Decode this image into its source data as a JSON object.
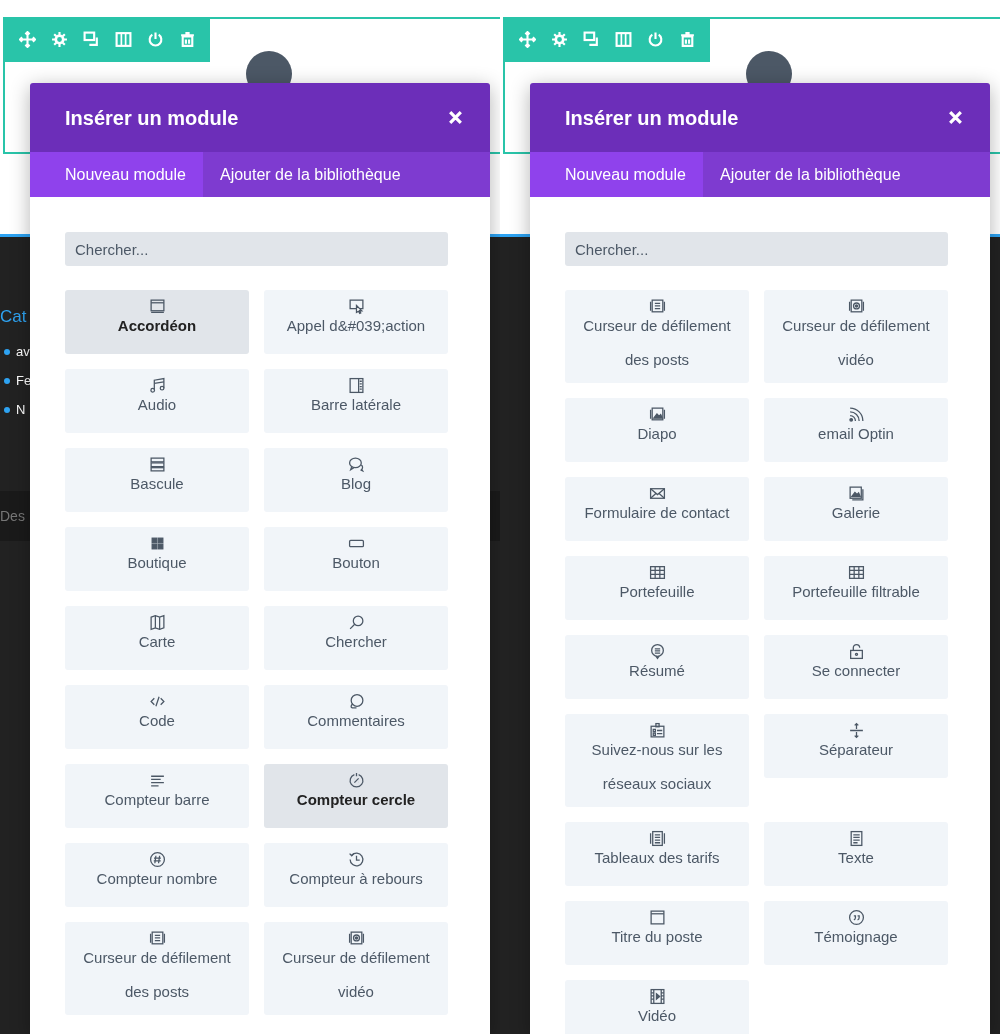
{
  "panels": [
    {
      "background": {
        "heading": "Cat",
        "bullets": [
          "av",
          "Fe",
          "N"
        ],
        "footer": "Des"
      },
      "modal": {
        "title": "Insérer un module",
        "tabs": [
          {
            "label": "Nouveau module",
            "selected": true
          },
          {
            "label": "Ajouter de la bibliothèque",
            "selected": false
          }
        ],
        "search": {
          "placeholder": "Chercher..."
        },
        "modules": [
          {
            "label": "Accordéon",
            "kind": "accordion",
            "highlighted": true
          },
          {
            "label": "Appel d&#039;action",
            "kind": "cta",
            "highlighted": false
          },
          {
            "label": "Audio",
            "kind": "audio",
            "highlighted": false
          },
          {
            "label": "Barre latérale",
            "kind": "sidebar",
            "highlighted": false
          },
          {
            "label": "Bascule",
            "kind": "toggle",
            "highlighted": false
          },
          {
            "label": "Blog",
            "kind": "blog",
            "highlighted": false
          },
          {
            "label": "Boutique",
            "kind": "shop",
            "highlighted": false
          },
          {
            "label": "Bouton",
            "kind": "button",
            "highlighted": false
          },
          {
            "label": "Carte",
            "kind": "map",
            "highlighted": false
          },
          {
            "label": "Chercher",
            "kind": "search",
            "highlighted": false
          },
          {
            "label": "Code",
            "kind": "code",
            "highlighted": false
          },
          {
            "label": "Commentaires",
            "kind": "comments",
            "highlighted": false
          },
          {
            "label": "Compteur barre",
            "kind": "barcounter",
            "highlighted": false
          },
          {
            "label": "Compteur cercle",
            "kind": "circlecounter",
            "highlighted": true
          },
          {
            "label": "Compteur nombre",
            "kind": "number",
            "highlighted": false
          },
          {
            "label": "Compteur à rebours",
            "kind": "countdown",
            "highlighted": false
          },
          {
            "label": "Curseur de défilement des posts",
            "kind": "postslider",
            "highlighted": false
          },
          {
            "label": "Curseur de défilement vidéo",
            "kind": "videoslider",
            "highlighted": false
          }
        ]
      }
    },
    {
      "modal": {
        "title": "Insérer un module",
        "tabs": [
          {
            "label": "Nouveau module",
            "selected": true
          },
          {
            "label": "Ajouter de la bibliothèque",
            "selected": false
          }
        ],
        "search": {
          "placeholder": "Chercher..."
        },
        "modules": [
          {
            "label": "Curseur de défilement des posts",
            "kind": "postslider",
            "highlighted": false
          },
          {
            "label": "Curseur de défilement vidéo",
            "kind": "videoslider",
            "highlighted": false
          },
          {
            "label": "Diapo",
            "kind": "slider",
            "highlighted": false
          },
          {
            "label": "email Optin",
            "kind": "optin",
            "highlighted": false
          },
          {
            "label": "Formulaire de contact",
            "kind": "contact",
            "highlighted": false
          },
          {
            "label": "Galerie",
            "kind": "gallery",
            "highlighted": false
          },
          {
            "label": "Portefeuille",
            "kind": "portfolio",
            "highlighted": false
          },
          {
            "label": "Portefeuille filtrable",
            "kind": "portfolio",
            "highlighted": false
          },
          {
            "label": "Résumé",
            "kind": "summary",
            "highlighted": false
          },
          {
            "label": "Se connecter",
            "kind": "login",
            "highlighted": false
          },
          {
            "label": "Suivez-nous sur les réseaux sociaux",
            "kind": "social",
            "highlighted": false
          },
          {
            "label": "Séparateur",
            "kind": "divider",
            "highlighted": false
          },
          {
            "label": "Tableaux des tarifs",
            "kind": "pricing",
            "highlighted": false
          },
          {
            "label": "Texte",
            "kind": "text",
            "highlighted": false
          },
          {
            "label": "Titre du poste",
            "kind": "posttitle",
            "highlighted": false
          },
          {
            "label": "Témoignage",
            "kind": "testimonial",
            "highlighted": false
          },
          {
            "label": "Vidéo",
            "kind": "video",
            "highlighted": false
          }
        ]
      }
    }
  ]
}
